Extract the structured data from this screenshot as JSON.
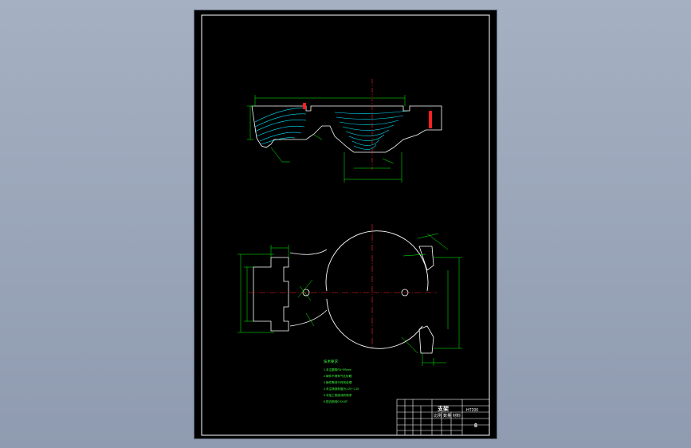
{
  "drawing": {
    "title": "支架",
    "sheet_no": "8",
    "tech_notes_title": "技术要求",
    "tech_notes": [
      "1.未注圆角R3~R5mm",
      "2.铸件不得有气孔砂眼",
      "3.铸件需进行时效处理",
      "4.未注铸造斜度为1:20~1:10",
      "5.非加工表面涂防锈漆",
      "6.锐边倒钝0.5X45°"
    ],
    "titleblock_cells": [
      "比例",
      "数量",
      "材料",
      "HT200"
    ],
    "colors": {
      "background": "#000000",
      "border": "#ffffff",
      "dimension": "#00ff00",
      "hatch": "#00e5ff",
      "centerline": "#ff2020",
      "outline": "#ffffff"
    }
  }
}
